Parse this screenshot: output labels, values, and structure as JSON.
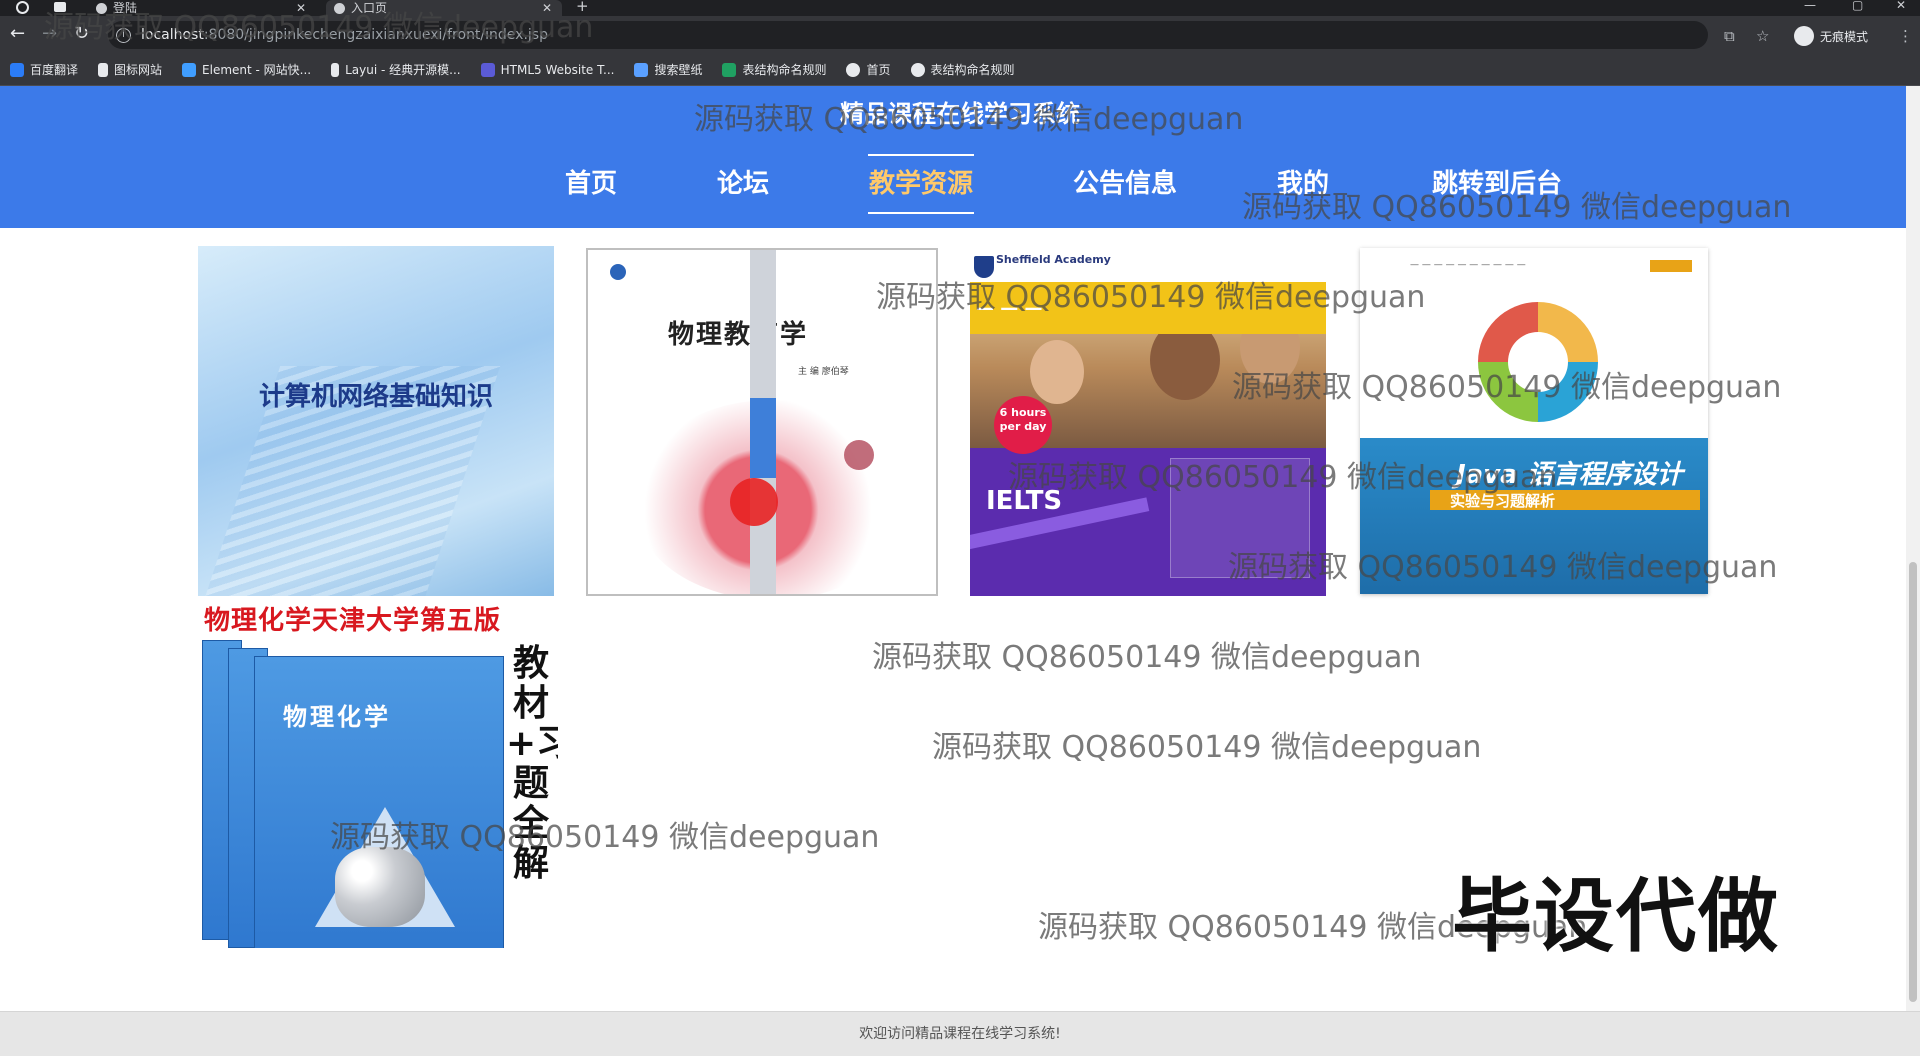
{
  "browser": {
    "tabs": [
      {
        "title": "登陆"
      },
      {
        "title": "入口页"
      }
    ],
    "new_tab_icon": "plus-icon",
    "url_host": "localhost",
    "url_rest": ":8080/jingpinkechengzaixianxuexi/front/index.jsp",
    "profile_label": "无痕模式",
    "bookmarks": [
      {
        "label": "百度翻译",
        "color": "#2b7cf7"
      },
      {
        "label": "图标网站",
        "color": "#e8eaed"
      },
      {
        "label": "Element - 网站快...",
        "color": "#409eff"
      },
      {
        "label": "Layui - 经典开源模...",
        "color": "#e8eaed"
      },
      {
        "label": "HTML5 Website T...",
        "color": "#5b5bd6"
      },
      {
        "label": "搜索壁纸",
        "color": "#5aa0ff"
      },
      {
        "label": "表结构命名规则",
        "color": "#20a162"
      },
      {
        "label": "首页",
        "color": "#e8eaed"
      },
      {
        "label": "表结构命名规则",
        "color": "#e8eaed"
      }
    ]
  },
  "site": {
    "title": "精品课程在线学习系统",
    "nav": [
      {
        "label": "首页"
      },
      {
        "label": "论坛"
      },
      {
        "label": "教学资源",
        "active": true
      },
      {
        "label": "公告信息"
      },
      {
        "label": "我的"
      },
      {
        "label": "跳转到后台"
      }
    ],
    "accent": "#3c7ae9",
    "active_color": "#ffc96a"
  },
  "resources": [
    {
      "cover_text": "计算机网络基础知识"
    },
    {
      "cover_text": "物理教育学",
      "cover_sub": "主 编  廖伯琴"
    },
    {
      "cover_text": "IELTS",
      "cover_sub": "Sheffield Academy",
      "badge": "6 hours per day"
    },
    {
      "cover_text": "Java 语言程序设计",
      "cover_sub": "实验与习题解析"
    },
    {
      "cover_text": "物理化学天津大学第五版",
      "cover_sub": "物理化学",
      "side_text": "教材+习题全解"
    }
  ],
  "watermark": "源码获取 QQ86050149 微信deepguan",
  "ad_text": "毕设代做",
  "footer_text": "欢迎访问精品课程在线学习系统!"
}
